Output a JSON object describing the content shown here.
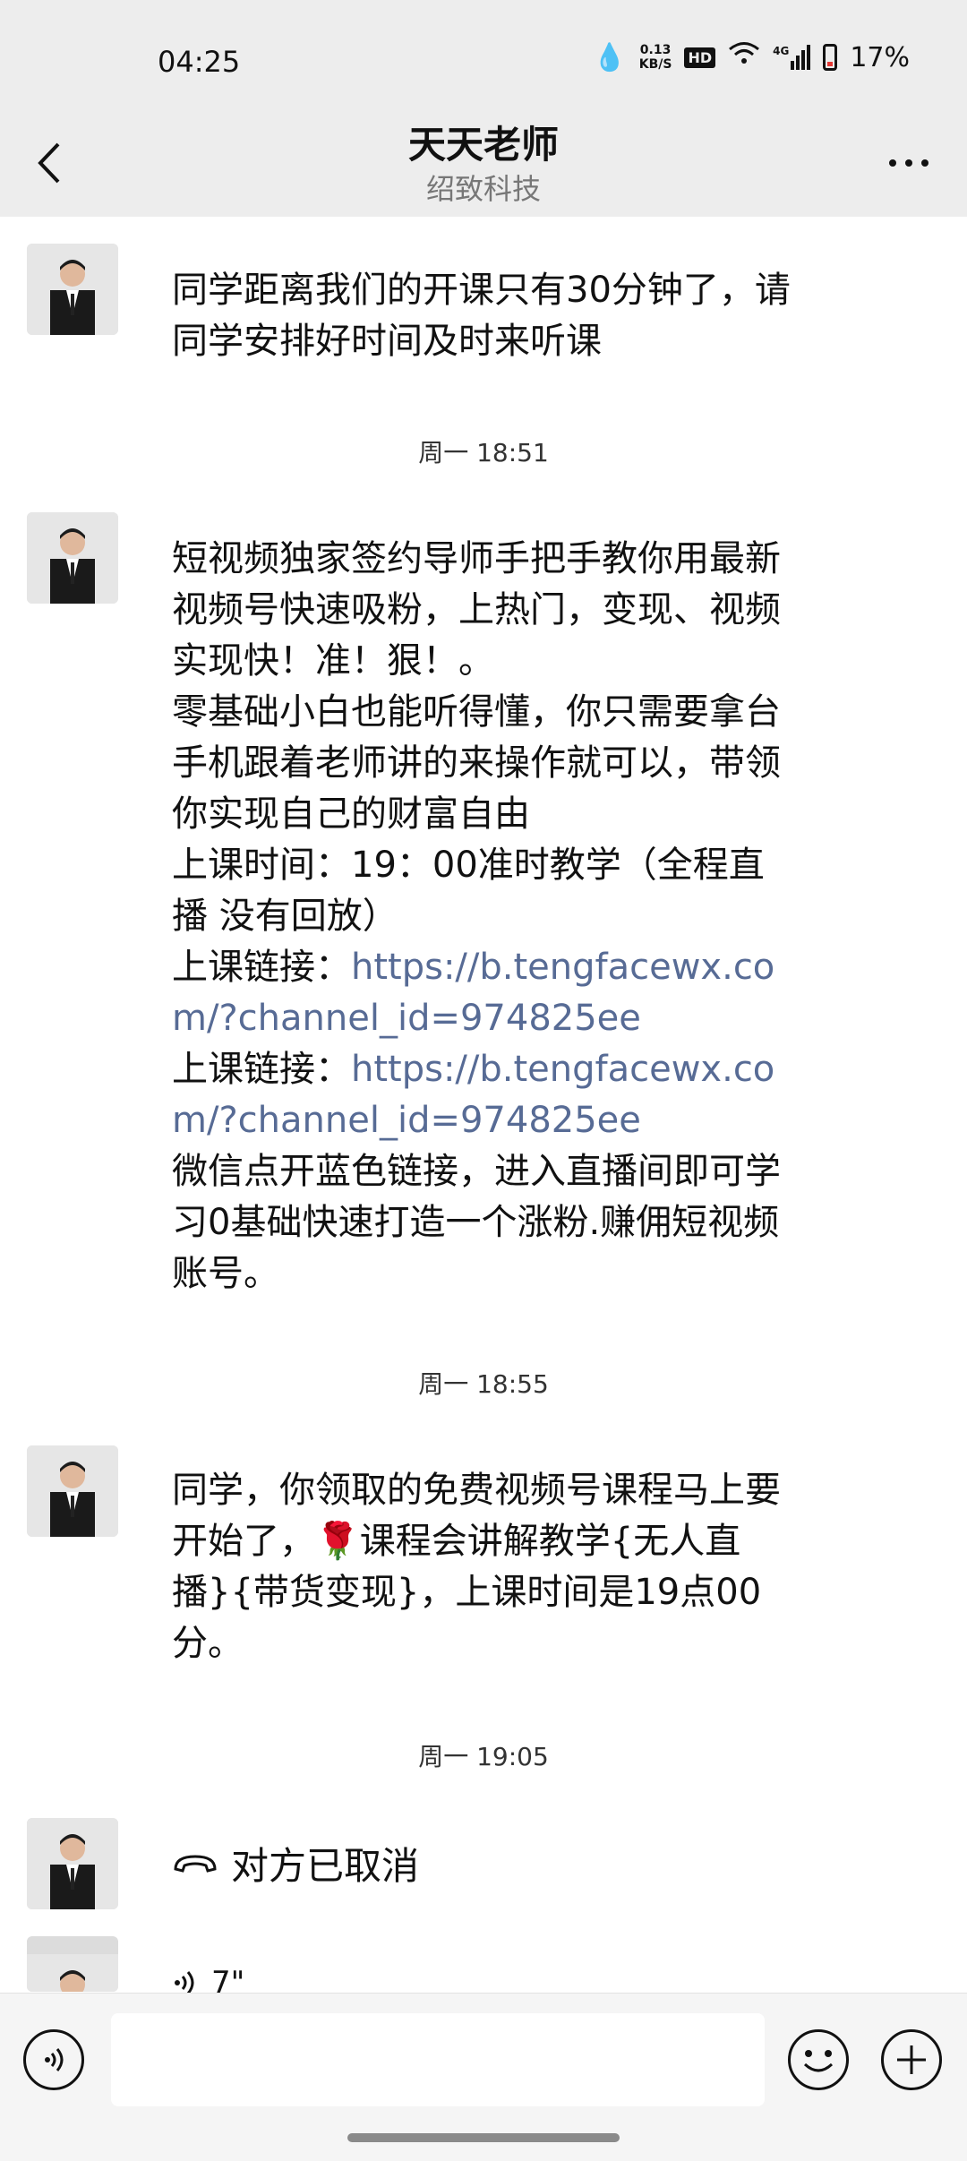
{
  "status_bar": {
    "time": "04:25",
    "net_speed_value": "0.13",
    "net_speed_unit": "KB/S",
    "hd_label": "HD",
    "signal_label": "4G",
    "battery": "17%"
  },
  "header": {
    "title": "天天老师",
    "subtitle": "绍致科技"
  },
  "messages": [
    {
      "text": "同学距离我们的开课只有30分钟了，请同学安排好时间及时来听课"
    },
    {
      "time": "周一 18:51"
    },
    {
      "text_parts": [
        "短视频独家签约导师手把手教你用最新视频号快速吸粉，上热门，变现、视频 实现快！准！狠！。\n零基础小白也能听得懂，你只需要拿台手机跟着老师讲的来操作就可以，带领你实现自己的财富自由\n上课时间：19：00准时教学（全程直播 没有回放）\n上课链接：",
        "https://b.tengfacewx.com/?channel_id=974825ee",
        "\n上课链接：",
        "https://b.tengfacewx.com/?channel_id=974825ee",
        "\n微信点开蓝色链接，进入直播间即可学习0基础快速打造一个涨粉.赚佣短视频账号。"
      ]
    },
    {
      "time": "周一 18:55"
    },
    {
      "text": "同学，你领取的免费视频号课程马上要开始了，🌹课程会讲解教学{无人直播}{带货变现}，上课时间是19点00分。"
    },
    {
      "time": "周一 19:05"
    },
    {
      "call_text": "对方已取消"
    },
    {
      "voice_duration": "7\""
    }
  ],
  "input_bar": {
    "placeholder": ""
  }
}
